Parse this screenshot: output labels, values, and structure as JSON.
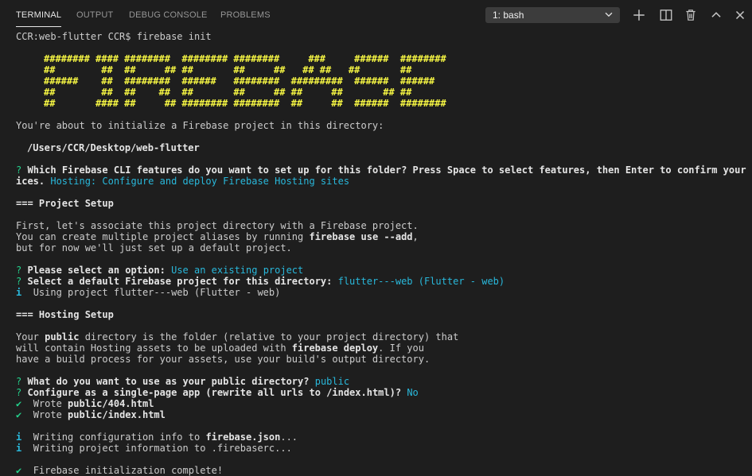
{
  "panel": {
    "tabs": [
      {
        "label": "TERMINAL",
        "active": true
      },
      {
        "label": "OUTPUT",
        "active": false
      },
      {
        "label": "DEBUG CONSOLE",
        "active": false
      },
      {
        "label": "PROBLEMS",
        "active": false
      }
    ],
    "terminal_select": "1: bash",
    "toolbar_icons": [
      "plus-icon",
      "split-icon",
      "trash-icon",
      "chevron-up-icon",
      "close-icon"
    ]
  },
  "colors": {
    "background": "#1e1e1e",
    "banner": "#f5f543",
    "accent_cyan": "#29b8db",
    "success_green": "#23d18b"
  },
  "terminal": {
    "prompt": "CCR:web-flutter CCR$ firebase init",
    "banner": [
      "######## #### ########  ######## ########     ###     ######  ########",
      "##        ##  ##     ## ##       ##     ##   ## ##   ##       ##",
      "######    ##  ########  ######   ########  #########  ######  ######",
      "##        ##  ##    ##  ##       ##     ## ##     ##       ## ##",
      "##       #### ##     ## ######## ########  ##     ##  ######  ########"
    ],
    "intro": "You're about to initialize a Firebase project in this directory:",
    "directory": "/Users/CCR/Desktop/web-flutter",
    "q_features": {
      "mark": "?",
      "question_l1": "Which Firebase CLI features do you want to set up for this folder? Press Space to select features, then Enter to confirm your cho",
      "question_l2": "ices.",
      "answer": "Hosting: Configure and deploy Firebase Hosting sites"
    },
    "project_setup_heading": "=== Project Setup",
    "project_text": {
      "l1": "First, let's associate this project directory with a Firebase project.",
      "l2_pre": "You can create multiple project aliases by running ",
      "l2_cmd": "firebase use --add",
      "l2_post": ",",
      "l3": "but for now we'll just set up a default project."
    },
    "q_option": {
      "mark": "?",
      "question": "Please select an option:",
      "answer": "Use an existing project"
    },
    "q_default": {
      "mark": "?",
      "question": "Select a default Firebase project for this directory:",
      "answer": "flutter---web (Flutter - web)"
    },
    "info_using": {
      "mark": "i",
      "text": "Using project flutter---web (Flutter - web)"
    },
    "hosting_setup_heading": "=== Hosting Setup",
    "hosting_text": {
      "l1_pre": "Your ",
      "l1_bold": "public",
      "l1_post": " directory is the folder (relative to your project directory) that",
      "l2_pre": "will contain Hosting assets to be uploaded with ",
      "l2_cmd": "firebase deploy",
      "l2_post": ". If you",
      "l3": "have a build process for your assets, use your build's output directory."
    },
    "q_public": {
      "mark": "?",
      "question": "What do you want to use as your public directory?",
      "answer": "public"
    },
    "q_spa": {
      "mark": "?",
      "question": "Configure as a single-page app (rewrite all urls to /index.html)?",
      "answer": "No"
    },
    "wrote1": {
      "mark": "✔",
      "pre": "Wrote ",
      "file": "public/404.html"
    },
    "wrote2": {
      "mark": "✔",
      "pre": "Wrote ",
      "file": "public/index.html"
    },
    "info_config": {
      "mark": "i",
      "pre": "Writing configuration info to ",
      "file": "firebase.json",
      "post": "..."
    },
    "info_project": {
      "mark": "i",
      "text": "Writing project information to .firebaserc..."
    },
    "complete": {
      "mark": "✔",
      "text": "Firebase initialization complete!"
    }
  }
}
